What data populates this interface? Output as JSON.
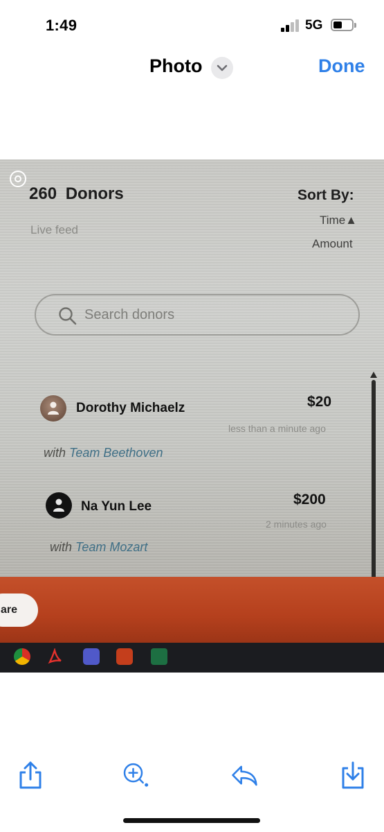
{
  "status_bar": {
    "time": "1:49",
    "network": "5G"
  },
  "nav": {
    "title": "Photo",
    "done_label": "Done"
  },
  "photo": {
    "donors_count": "260 Donors",
    "live_feed": "Live feed",
    "sort_by": "Sort By:",
    "sort_options": [
      "Time▲",
      "Amount"
    ],
    "search": {
      "placeholder": "Search donors"
    },
    "donors": [
      {
        "name": "Dorothy Michaelz",
        "amount": "$20",
        "time": "less than a minute ago",
        "team_prefix": "with",
        "team": "Team Beethoven"
      },
      {
        "name": "Na Yun Lee",
        "amount": "$200",
        "time": "2 minutes ago",
        "team_prefix": "with",
        "team": "Team Mozart"
      }
    ],
    "share_partial": "are",
    "taskbar_icons": [
      "chrome-icon",
      "acrobat-icon",
      "teams-icon",
      "powerpoint-icon",
      "excel-icon"
    ]
  },
  "toolbar": {
    "icons": [
      "share-icon",
      "visual-lookup-icon",
      "reply-icon",
      "save-icon"
    ],
    "accent": "#2f80e8"
  },
  "colors": {
    "accent": "#2f80e8",
    "orange_band": "#b5401d"
  }
}
